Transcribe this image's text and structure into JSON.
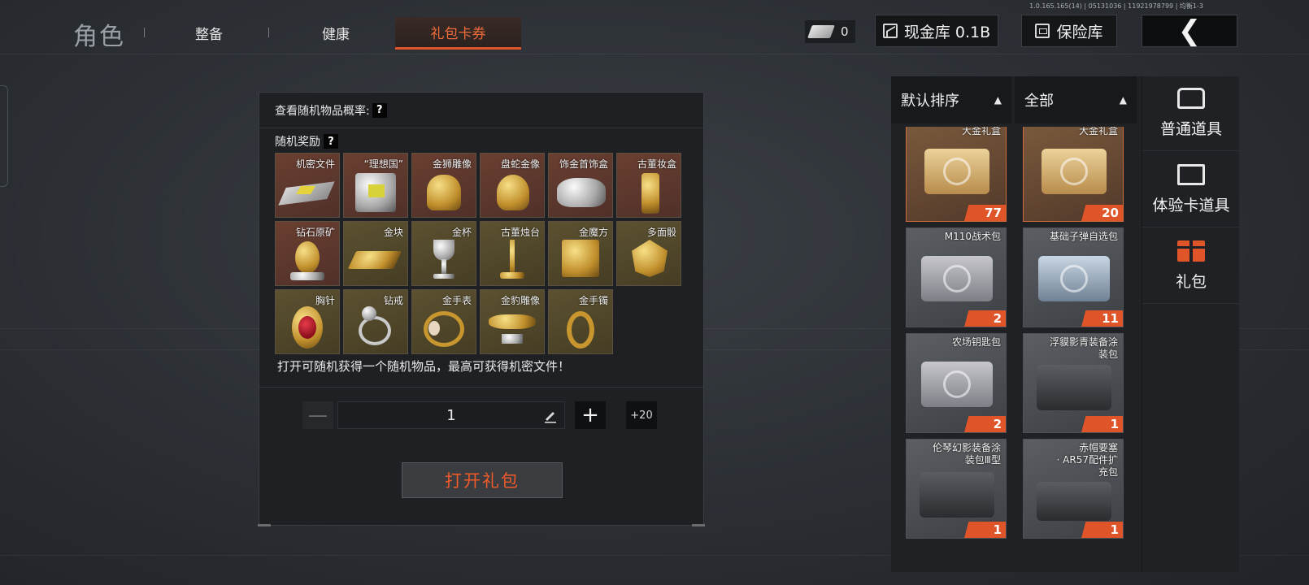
{
  "version": "1.0.165.165(14) | 05131036 | 11921978799 | 均衡1-3",
  "header": {
    "title": "角色",
    "tabs": [
      "整备",
      "健康",
      "礼包卡券"
    ],
    "ticket_count": "0",
    "cash_label": "现金库 0.1B",
    "safe_label": "保险库",
    "back_glyph": "❮"
  },
  "panel": {
    "probability_label": "查看随机物品概率:",
    "reward_label": "随机奖励",
    "help_glyph": "?",
    "rewards": [
      {
        "name": "机密文件",
        "icon": "document-icon"
      },
      {
        "name": "“理想国”",
        "icon": "safe-icon"
      },
      {
        "name": "金狮雕像",
        "icon": "lion-statue-icon"
      },
      {
        "name": "盘蛇金像",
        "icon": "snake-statue-icon"
      },
      {
        "name": "饰金首饰盒",
        "icon": "jewelry-box-icon"
      },
      {
        "name": "古董妆盒",
        "icon": "antique-case-icon"
      },
      {
        "name": "钻石原矿",
        "icon": "diamond-ore-icon"
      },
      {
        "name": "金块",
        "icon": "gold-bar-icon"
      },
      {
        "name": "金杯",
        "icon": "gold-cup-icon"
      },
      {
        "name": "古董烛台",
        "icon": "candlestick-icon"
      },
      {
        "name": "金魔方",
        "icon": "gold-cube-icon"
      },
      {
        "name": "多面骰",
        "icon": "dice-icon"
      },
      {
        "name": "胸针",
        "icon": "brooch-icon"
      },
      {
        "name": "钻戒",
        "icon": "diamond-ring-icon"
      },
      {
        "name": "金手表",
        "icon": "gold-watch-icon"
      },
      {
        "name": "金豹雕像",
        "icon": "leopard-statue-icon"
      },
      {
        "name": "金手镯",
        "icon": "gold-bracelet-icon"
      }
    ],
    "description": "打开可随机获得一个随机物品，最高可获得机密文件！",
    "minus_glyph": "—",
    "quantity": "1",
    "plus_glyph": "+",
    "plus20_label": "+20",
    "open_button": "打开礼包"
  },
  "inventory": {
    "sort_label": "默认排序",
    "filter_label": "全部",
    "caret": "▲",
    "items": [
      {
        "name": "大金礼盒",
        "count": "77",
        "style": "gold"
      },
      {
        "name": "大金礼盒",
        "count": "20",
        "style": "gold"
      },
      {
        "name": "M110战术包",
        "count": "2",
        "style": "grey"
      },
      {
        "name": "基础子弹自选包",
        "count": "11",
        "style": "blue"
      },
      {
        "name": "农场钥匙包",
        "count": "2",
        "style": "grey"
      },
      {
        "name": "浮貘影青装备涂\n装包",
        "count": "1",
        "style": "dark"
      },
      {
        "name": "伦琴幻影装备涂\n装包Ⅲ型",
        "count": "1",
        "style": "dark"
      },
      {
        "name": "赤帽要塞\n· AR57配件扩\n充包",
        "count": "1",
        "style": "dark"
      }
    ]
  },
  "categories": [
    {
      "label": "普通道具",
      "icon": "chest-icon"
    },
    {
      "label": "体验卡道具",
      "icon": "card-icon"
    },
    {
      "label": "礼包",
      "icon": "gift-icon"
    }
  ],
  "colors": {
    "accent": "#e0542a",
    "panel": "#1e2023"
  }
}
